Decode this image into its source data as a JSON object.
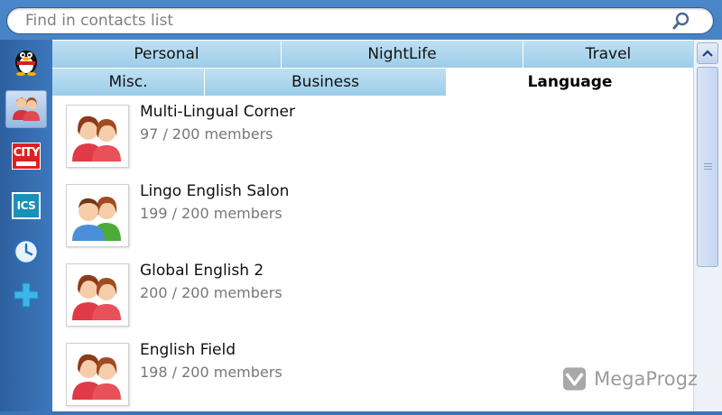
{
  "search": {
    "placeholder": "Find in contacts list",
    "value": ""
  },
  "rail": {
    "items": [
      {
        "icon": "penguin-icon",
        "active": false
      },
      {
        "icon": "contacts-group-icon",
        "active": true
      },
      {
        "icon": "city-icon",
        "label": "CITY",
        "active": false
      },
      {
        "icon": "ics-icon",
        "label": "ICS",
        "active": false
      },
      {
        "icon": "clock-icon",
        "active": false
      },
      {
        "icon": "add-icon",
        "active": false
      }
    ]
  },
  "tabs": {
    "row1": [
      {
        "label": "Personal"
      },
      {
        "label": "NightLife"
      },
      {
        "label": "Travel"
      }
    ],
    "row2": [
      {
        "label": "Misc."
      },
      {
        "label": "Business"
      },
      {
        "label": "Language",
        "active": true
      }
    ]
  },
  "groups": [
    {
      "name": "Multi-Lingual Corner",
      "members": "97 / 200 members",
      "avatar": "two-women"
    },
    {
      "name": "Lingo English Salon",
      "members": "199 / 200 members",
      "avatar": "man-woman"
    },
    {
      "name": "Global English 2",
      "members": "200 / 200 members",
      "avatar": "two-women"
    },
    {
      "name": "English Field",
      "members": "198 / 200 members",
      "avatar": "two-women"
    }
  ],
  "watermark": {
    "text": "MegaProgz"
  },
  "colors": {
    "tab_bg": "#9ccde9",
    "active_tab": "#ffffff",
    "frame": "#3b74b8"
  }
}
